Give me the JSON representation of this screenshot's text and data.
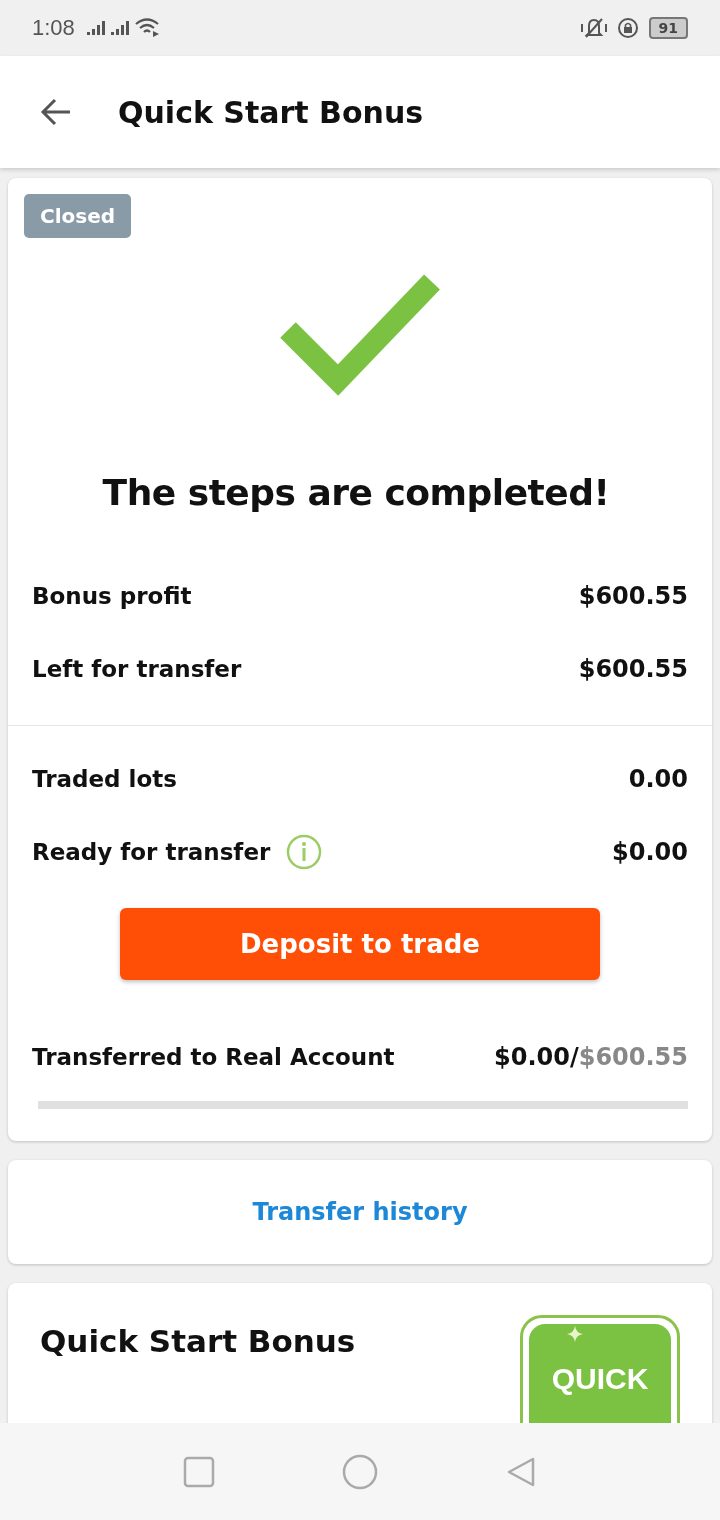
{
  "status_bar": {
    "time": "1:08",
    "battery": "91"
  },
  "header": {
    "title": "Quick Start Bonus"
  },
  "bonus_card": {
    "status": "Closed",
    "heading": "The steps are completed!",
    "summary_rows": [
      {
        "label": "Bonus profit",
        "value": "$600.55",
        "info": false
      },
      {
        "label": "Left for transfer",
        "value": "$600.55",
        "info": false
      }
    ],
    "trade_rows": [
      {
        "label": "Traded lots",
        "value": "0.00",
        "info": false
      },
      {
        "label": "Ready for transfer",
        "value": "$0.00",
        "info": true
      }
    ],
    "button": "Deposit to trade",
    "transferred": {
      "label": "Transferred to Real Account",
      "value": "$0.00/",
      "total": "$600.55",
      "level": 0
    }
  },
  "transfer_history": "Transfer history",
  "promo": {
    "title": "Quick Start Bonus",
    "badge": "QUICK"
  }
}
